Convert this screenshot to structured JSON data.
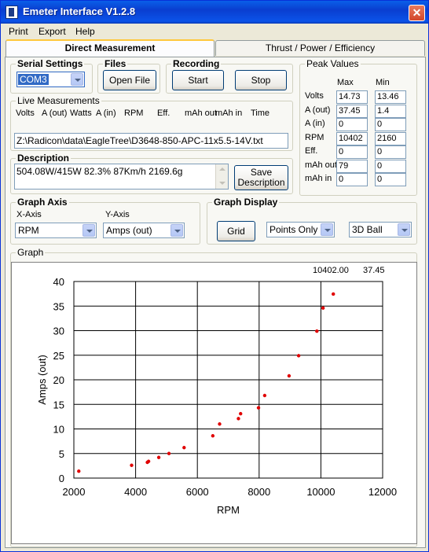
{
  "window": {
    "title": "Emeter Interface V1.2.8",
    "close_glyph": "✕"
  },
  "menubar": [
    "Print",
    "Export",
    "Help"
  ],
  "tabs": [
    {
      "label": "Direct Measurement",
      "active": true
    },
    {
      "label": "Thrust / Power / Efficiency",
      "active": false
    }
  ],
  "serial": {
    "legend": "Serial Settings",
    "port": "COM3"
  },
  "files": {
    "legend": "Files",
    "open_label": "Open File"
  },
  "recording": {
    "legend": "Recording",
    "start_label": "Start",
    "stop_label": "Stop"
  },
  "live": {
    "legend": "Live Measurements",
    "headers": [
      "Volts",
      "A (out)",
      "Watts",
      "A (in)",
      "RPM",
      "Eff.",
      "mAh out",
      "mAh in",
      "Time"
    ],
    "file_path": "Z:\\Radicon\\data\\EagleTree\\D3648-850-APC-11x5.5-14V.txt"
  },
  "description": {
    "legend": "Description",
    "text": "504.08W/415W 82.3% 87Km/h 2169.6g",
    "save_label": "Save Description"
  },
  "peak": {
    "legend": "Peak Values",
    "max_label": "Max",
    "min_label": "Min",
    "rows": [
      {
        "label": "Volts",
        "max": "14.73",
        "min": "13.46"
      },
      {
        "label": "A (out)",
        "max": "37.45",
        "min": "1.4"
      },
      {
        "label": "A (in)",
        "max": "0",
        "min": "0"
      },
      {
        "label": "RPM",
        "max": "10402",
        "min": "2160"
      },
      {
        "label": "Eff.",
        "max": "0",
        "min": "0"
      },
      {
        "label": "mAh out",
        "max": "79",
        "min": "0"
      },
      {
        "label": "mAh in",
        "max": "0",
        "min": "0"
      }
    ]
  },
  "graph_axis": {
    "legend": "Graph Axis",
    "x_label": "X-Axis",
    "x_value": "RPM",
    "y_label": "Y-Axis",
    "y_value": "Amps (out)"
  },
  "graph_display": {
    "legend": "Graph Display",
    "grid_label": "Grid",
    "mode": "Points Only",
    "style": "3D Ball"
  },
  "graph": {
    "legend": "Graph",
    "cursor_x": "10402.00",
    "cursor_y": "37.45"
  },
  "colors": {
    "point": "#e00000",
    "titlebar": "#0a3ed0"
  },
  "chart_data": {
    "type": "scatter",
    "xlabel": "RPM",
    "ylabel": "Amps (out)",
    "xlim": [
      2000,
      12000
    ],
    "ylim": [
      0,
      40
    ],
    "xticks": [
      2000,
      4000,
      6000,
      8000,
      10000,
      12000
    ],
    "yticks": [
      0,
      5,
      10,
      15,
      20,
      25,
      30,
      35,
      40
    ],
    "grid": true,
    "x": [
      2160,
      3870,
      4380,
      4420,
      4750,
      5080,
      5570,
      6500,
      6720,
      7330,
      7400,
      7980,
      8180,
      8970,
      9280,
      9870,
      10070,
      10402
    ],
    "y": [
      1.4,
      2.6,
      3.2,
      3.4,
      4.2,
      5.0,
      6.2,
      8.6,
      11.0,
      12.1,
      13.1,
      14.3,
      16.8,
      20.8,
      24.9,
      29.9,
      34.6,
      37.45
    ]
  }
}
